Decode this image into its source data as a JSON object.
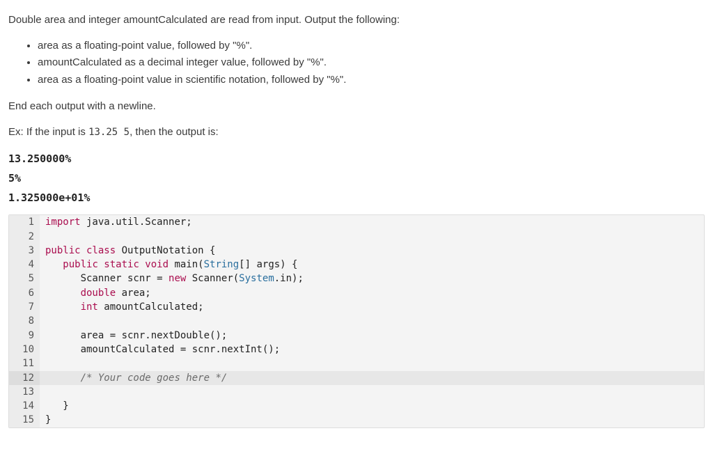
{
  "intro": "Double area and integer amountCalculated are read from input. Output the following:",
  "bullets": [
    "area as a floating-point value, followed by \"%\".",
    "amountCalculated as a decimal integer value, followed by \"%\".",
    "area as a floating-point value in scientific notation, followed by \"%\"."
  ],
  "endOutput": "End each output with a newline.",
  "exampleLabel_prefix": "Ex: If the input is ",
  "exampleInput": "13.25  5",
  "exampleLabel_suffix": ", then the output is:",
  "exampleOutput": [
    "13.250000%",
    "5%",
    "1.325000e+01%"
  ],
  "code": {
    "highlightLine": 12,
    "lines": [
      {
        "n": 1,
        "tokens": [
          {
            "t": "import",
            "c": "kw"
          },
          {
            "t": " java.util.Scanner;",
            "c": "ident"
          }
        ]
      },
      {
        "n": 2,
        "tokens": [
          {
            "t": "",
            "c": "ident"
          }
        ]
      },
      {
        "n": 3,
        "tokens": [
          {
            "t": "public class",
            "c": "kw"
          },
          {
            "t": " OutputNotation {",
            "c": "ident"
          }
        ]
      },
      {
        "n": 4,
        "tokens": [
          {
            "t": "   ",
            "c": "ident"
          },
          {
            "t": "public static void",
            "c": "kw"
          },
          {
            "t": " main(",
            "c": "ident"
          },
          {
            "t": "String",
            "c": "cls"
          },
          {
            "t": "[] args) {",
            "c": "ident"
          }
        ]
      },
      {
        "n": 5,
        "tokens": [
          {
            "t": "      Scanner scnr = ",
            "c": "ident"
          },
          {
            "t": "new",
            "c": "kw"
          },
          {
            "t": " Scanner(",
            "c": "ident"
          },
          {
            "t": "System",
            "c": "cls"
          },
          {
            "t": ".in);",
            "c": "ident"
          }
        ]
      },
      {
        "n": 6,
        "tokens": [
          {
            "t": "      ",
            "c": "ident"
          },
          {
            "t": "double",
            "c": "type"
          },
          {
            "t": " area;",
            "c": "ident"
          }
        ]
      },
      {
        "n": 7,
        "tokens": [
          {
            "t": "      ",
            "c": "ident"
          },
          {
            "t": "int",
            "c": "type"
          },
          {
            "t": " amountCalculated;",
            "c": "ident"
          }
        ]
      },
      {
        "n": 8,
        "tokens": [
          {
            "t": "",
            "c": "ident"
          }
        ]
      },
      {
        "n": 9,
        "tokens": [
          {
            "t": "      area = scnr.nextDouble();",
            "c": "ident"
          }
        ]
      },
      {
        "n": 10,
        "tokens": [
          {
            "t": "      amountCalculated = scnr.nextInt();",
            "c": "ident"
          }
        ]
      },
      {
        "n": 11,
        "tokens": [
          {
            "t": "",
            "c": "ident"
          }
        ]
      },
      {
        "n": 12,
        "tokens": [
          {
            "t": "      ",
            "c": "ident"
          },
          {
            "t": "/* Your code goes here */",
            "c": "comment"
          }
        ]
      },
      {
        "n": 13,
        "tokens": [
          {
            "t": "",
            "c": "ident"
          }
        ]
      },
      {
        "n": 14,
        "tokens": [
          {
            "t": "   }",
            "c": "ident"
          }
        ]
      },
      {
        "n": 15,
        "tokens": [
          {
            "t": "}",
            "c": "ident"
          }
        ]
      }
    ]
  }
}
